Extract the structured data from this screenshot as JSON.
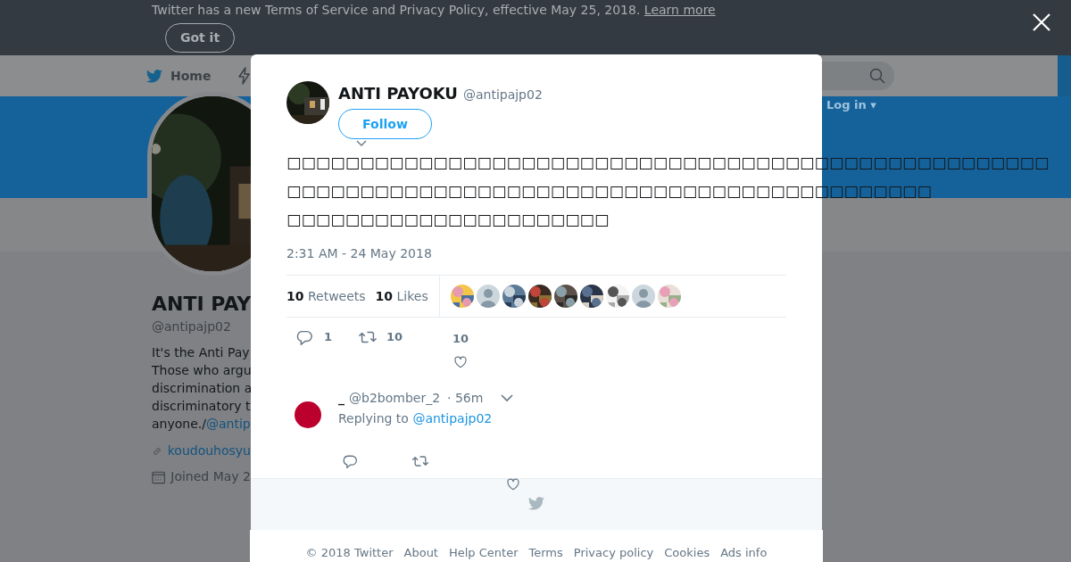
{
  "notice": {
    "text": "Twitter has a new Terms of Service and Privacy Policy, effective May 25, 2018.",
    "link": "Learn more",
    "button": "Got it"
  },
  "nav": {
    "home": "Home",
    "login": "Log in ▾"
  },
  "profile": {
    "name": "ANTI PAY",
    "handle": "@antipajp02",
    "bio_lines": [
      "It's the Anti Pay",
      "Those who argu",
      "discrimination a",
      "discriminatory t"
    ],
    "bio_last": "anyone./",
    "bio_link": "@antip",
    "website": "koudouhosyu",
    "joined": "Joined May 2"
  },
  "tweet": {
    "name": "ANTI PAYOKU",
    "handle": "@antipajp02",
    "follow": "Follow",
    "text_lines": [
      "□□□□□□□□□□□□□□□□□□□□□□□□□□□□□□□□□□□□□□□□□□□□□□□□□□□□",
      "□□□□□□□□□□□□□□□□□□□□□□□□□□□□□□□□□□□□□□□□□□□□",
      "□□□□□□□□□□□□□□□□□□□□□□"
    ],
    "timestamp": "2:31 AM - 24 May 2018",
    "stats": [
      {
        "count": "10",
        "label": "Retweets"
      },
      {
        "count": "10",
        "label": "Likes"
      }
    ],
    "likers": [
      {
        "kind": "picture"
      },
      {
        "kind": "default"
      },
      {
        "kind": "picture"
      },
      {
        "kind": "picture"
      },
      {
        "kind": "picture"
      },
      {
        "kind": "picture"
      },
      {
        "kind": "picture"
      },
      {
        "kind": "default"
      },
      {
        "kind": "picture"
      }
    ],
    "actions": {
      "replies": "1",
      "retweets": "10",
      "likes": "10"
    }
  },
  "reply": {
    "name": "_",
    "handle": "@b2bomber_2",
    "time": "· 56m",
    "replying_label": "Replying to",
    "replying_to": "@antipajp02"
  },
  "footer": [
    "© 2018 Twitter",
    "About",
    "Help Center",
    "Terms",
    "Privacy policy",
    "Cookies",
    "Ads info"
  ]
}
